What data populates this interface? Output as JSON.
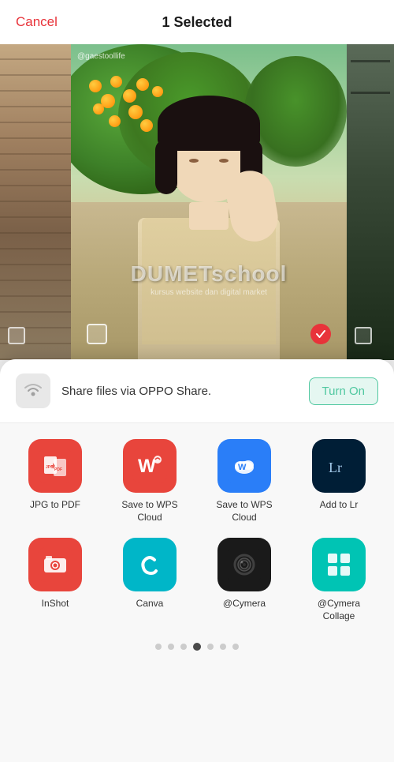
{
  "header": {
    "cancel_label": "Cancel",
    "title": "1 Selected"
  },
  "oppo_share": {
    "text": "Share files via OPPO Share.",
    "button_label": "Turn On"
  },
  "apps": [
    {
      "id": "jpg-to-pdf",
      "label": "JPG to PDF",
      "icon_type": "jpg-pdf"
    },
    {
      "id": "save-wps-1",
      "label": "Save to WPS Cloud",
      "icon_type": "wps-red"
    },
    {
      "id": "save-wps-2",
      "label": "Save to WPS Cloud",
      "icon_type": "wps-blue"
    },
    {
      "id": "add-lr",
      "label": "Add to Lr",
      "icon_type": "lr"
    },
    {
      "id": "inshot",
      "label": "InShot",
      "icon_type": "inshot"
    },
    {
      "id": "canva",
      "label": "Canva",
      "icon_type": "canva"
    },
    {
      "id": "cymera",
      "label": "@Cymera",
      "icon_type": "cymera"
    },
    {
      "id": "cymera-collage",
      "label": "@Cymera Collage",
      "icon_type": "cymera-collage"
    }
  ],
  "dots": {
    "total": 7,
    "active_index": 3
  },
  "watermark": {
    "main": "DUMETschool",
    "sub": "kursus website dan digital market"
  },
  "photo": {
    "username": "@gaestoollife"
  }
}
